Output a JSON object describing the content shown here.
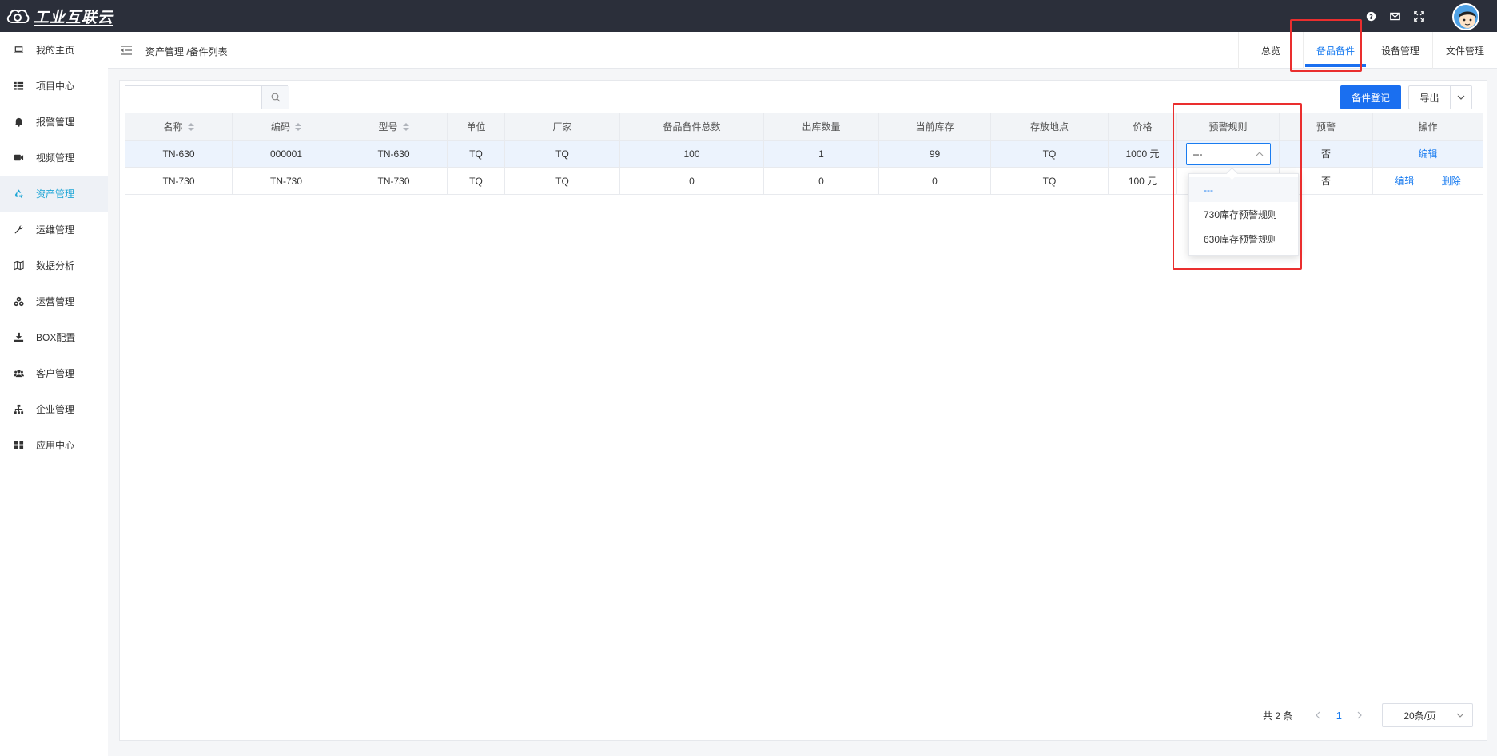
{
  "app": {
    "logo_text": "工业互联云"
  },
  "topbar": {
    "icons": [
      "help-icon",
      "mail-icon",
      "fullscreen-icon"
    ],
    "avatar": "user-avatar"
  },
  "sidebar": {
    "items": [
      {
        "label": "我的主页",
        "icon": "laptop-icon",
        "active": false
      },
      {
        "label": "项目中心",
        "icon": "list-icon",
        "active": false
      },
      {
        "label": "报警管理",
        "icon": "bell-icon",
        "active": false
      },
      {
        "label": "视频管理",
        "icon": "video-icon",
        "active": false
      },
      {
        "label": "资产管理",
        "icon": "recycle-icon",
        "active": true
      },
      {
        "label": "运维管理",
        "icon": "wrench-icon",
        "active": false
      },
      {
        "label": "数据分析",
        "icon": "map-icon",
        "active": false
      },
      {
        "label": "运营管理",
        "icon": "cubes-icon",
        "active": false
      },
      {
        "label": "BOX配置",
        "icon": "download-icon",
        "active": false
      },
      {
        "label": "客户管理",
        "icon": "users-icon",
        "active": false
      },
      {
        "label": "企业管理",
        "icon": "sitemap-icon",
        "active": false
      },
      {
        "label": "应用中心",
        "icon": "grid-icon",
        "active": false
      }
    ]
  },
  "header": {
    "breadcrumb": "资产管理 /备件列表",
    "tabs": [
      {
        "label": "总览",
        "active": false
      },
      {
        "label": "备品备件",
        "active": true
      },
      {
        "label": "设备管理",
        "active": false
      },
      {
        "label": "文件管理",
        "active": false
      }
    ]
  },
  "toolbar": {
    "search_value": "",
    "search_placeholder": "",
    "register_label": "备件登记",
    "export_label": "导出"
  },
  "table": {
    "columns": [
      "名称",
      "编码",
      "型号",
      "单位",
      "厂家",
      "备品备件总数",
      "出库数量",
      "当前库存",
      "存放地点",
      "价格",
      "预警规则",
      "预警",
      "操作"
    ],
    "rows": [
      {
        "name": "TN-630",
        "code": "000001",
        "model": "TN-630",
        "unit": "TQ",
        "maker": "TQ",
        "total": "100",
        "out": "1",
        "stock": "99",
        "location": "TQ",
        "price": "1000 元",
        "rule": "---",
        "alert": "否",
        "actions": [
          "编辑"
        ]
      },
      {
        "name": "TN-730",
        "code": "TN-730",
        "model": "TN-730",
        "unit": "TQ",
        "maker": "TQ",
        "total": "0",
        "out": "0",
        "stock": "0",
        "location": "TQ",
        "price": "100 元",
        "rule": "",
        "alert": "否",
        "actions": [
          "编辑",
          "删除"
        ]
      }
    ]
  },
  "dropdown": {
    "options": [
      "---",
      "730库存预警规则",
      "630库存预警规则"
    ],
    "selected": "---"
  },
  "pagination": {
    "total_text": "共 2 条",
    "current_page": "1",
    "page_size": "20条/页"
  },
  "colors": {
    "accent": "#1a6ff0",
    "highlight": "#ea2e2e",
    "topbar": "#2b2f3a"
  }
}
